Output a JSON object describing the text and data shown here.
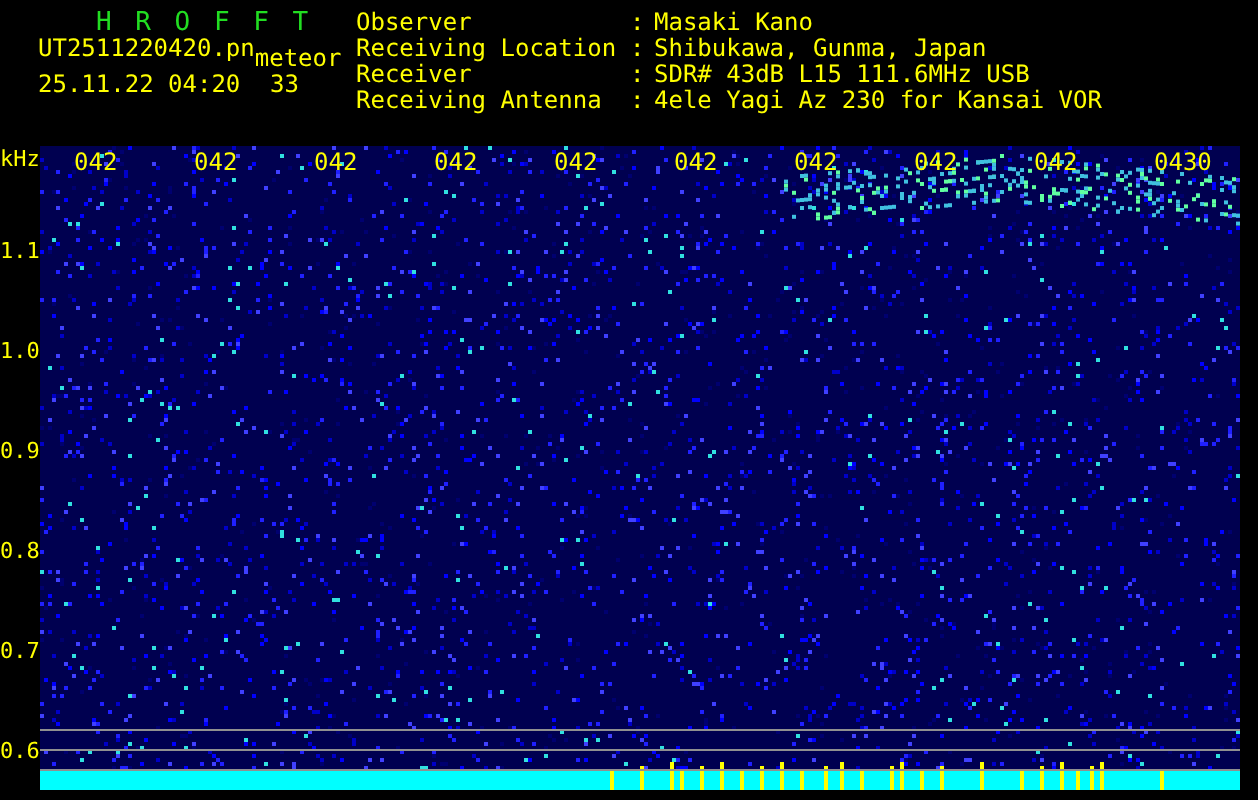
{
  "header": {
    "program": "H R O F F T",
    "filename": "UT2511220420.pn",
    "mode": "meteor",
    "datetime": "25.11.22 04:20",
    "count": "33"
  },
  "station": [
    {
      "label": "Observer",
      "separator": ":",
      "value": "Masaki Kano"
    },
    {
      "label": "Receiving Location",
      "separator": ":",
      "value": "Shibukawa, Gunma, Japan"
    },
    {
      "label": "Receiver",
      "separator": ":",
      "value": "SDR# 43dB L15 111.6MHz USB"
    },
    {
      "label": "Receiving Antenna",
      "separator": ":",
      "value": "4ele Yagi Az 230 for Kansai VOR"
    }
  ],
  "plot": {
    "unit": "kHz",
    "y_labels": [
      "1.1",
      "1.0",
      "0.9",
      "0.8",
      "0.7",
      "0.6"
    ],
    "time_labels": [
      "042",
      "042",
      "042",
      "042",
      "042",
      "042",
      "042",
      "042",
      "042",
      "0430"
    ]
  }
}
